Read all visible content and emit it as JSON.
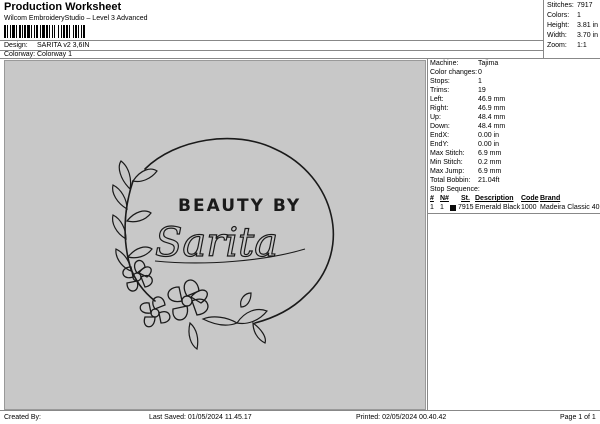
{
  "header": {
    "title": "Production Worksheet",
    "subtitle": "Wilcom EmbroideryStudio – Level 3 Advanced",
    "design_label": "Design:",
    "design_value": "SARITA v2 3,6IN",
    "colorway_label": "Colorway:",
    "colorway_value": "Colorway 1"
  },
  "stats": [
    {
      "label": "Stitches:",
      "value": "7917"
    },
    {
      "label": "Colors:",
      "value": "1"
    },
    {
      "label": "Height:",
      "value": "3.81 in"
    },
    {
      "label": "Width:",
      "value": "3.70 in"
    },
    {
      "label": "Zoom:",
      "value": "1:1"
    }
  ],
  "info": [
    {
      "label": "Machine:",
      "value": "Tajima"
    },
    {
      "label": "Color changes:",
      "value": "0"
    },
    {
      "label": "Stops:",
      "value": "1"
    },
    {
      "label": "Trims:",
      "value": "19"
    },
    {
      "label": "Left:",
      "value": "46.9 mm"
    },
    {
      "label": "Right:",
      "value": "46.9 mm"
    },
    {
      "label": "Up:",
      "value": "48.4 mm"
    },
    {
      "label": "Down:",
      "value": "48.4 mm"
    },
    {
      "label": "EndX:",
      "value": "0.00 in"
    },
    {
      "label": "EndY:",
      "value": "0.00 in"
    },
    {
      "label": "Max Stitch:",
      "value": "6.9 mm"
    },
    {
      "label": "Min Stitch:",
      "value": "0.2 mm"
    },
    {
      "label": "Max Jump:",
      "value": "6.9 mm"
    },
    {
      "label": "Total Bobbin:",
      "value": "21.04ft"
    }
  ],
  "stop_sequence": {
    "label": "Stop Sequence:",
    "headers": [
      "#",
      "N#",
      "St.",
      "Description",
      "Code",
      "Brand"
    ],
    "rows": [
      {
        "num": "1",
        "n": "1",
        "color": "#0a0a0a",
        "st": "7915",
        "description": "Emerald Black",
        "code": "1000",
        "brand": "Madeira Classic 40"
      }
    ]
  },
  "design": {
    "text_line1": "BEAUTY BY",
    "text_line2": "Sarita",
    "background": "#c8c8c8",
    "ink": "#1a1a1a"
  },
  "footer": {
    "created_by": "Created By:",
    "last_saved": "Last Saved: 01/05/2024 11.45.17",
    "printed": "Printed: 02/05/2024 00.40.42",
    "page": "Page 1 of 1"
  }
}
